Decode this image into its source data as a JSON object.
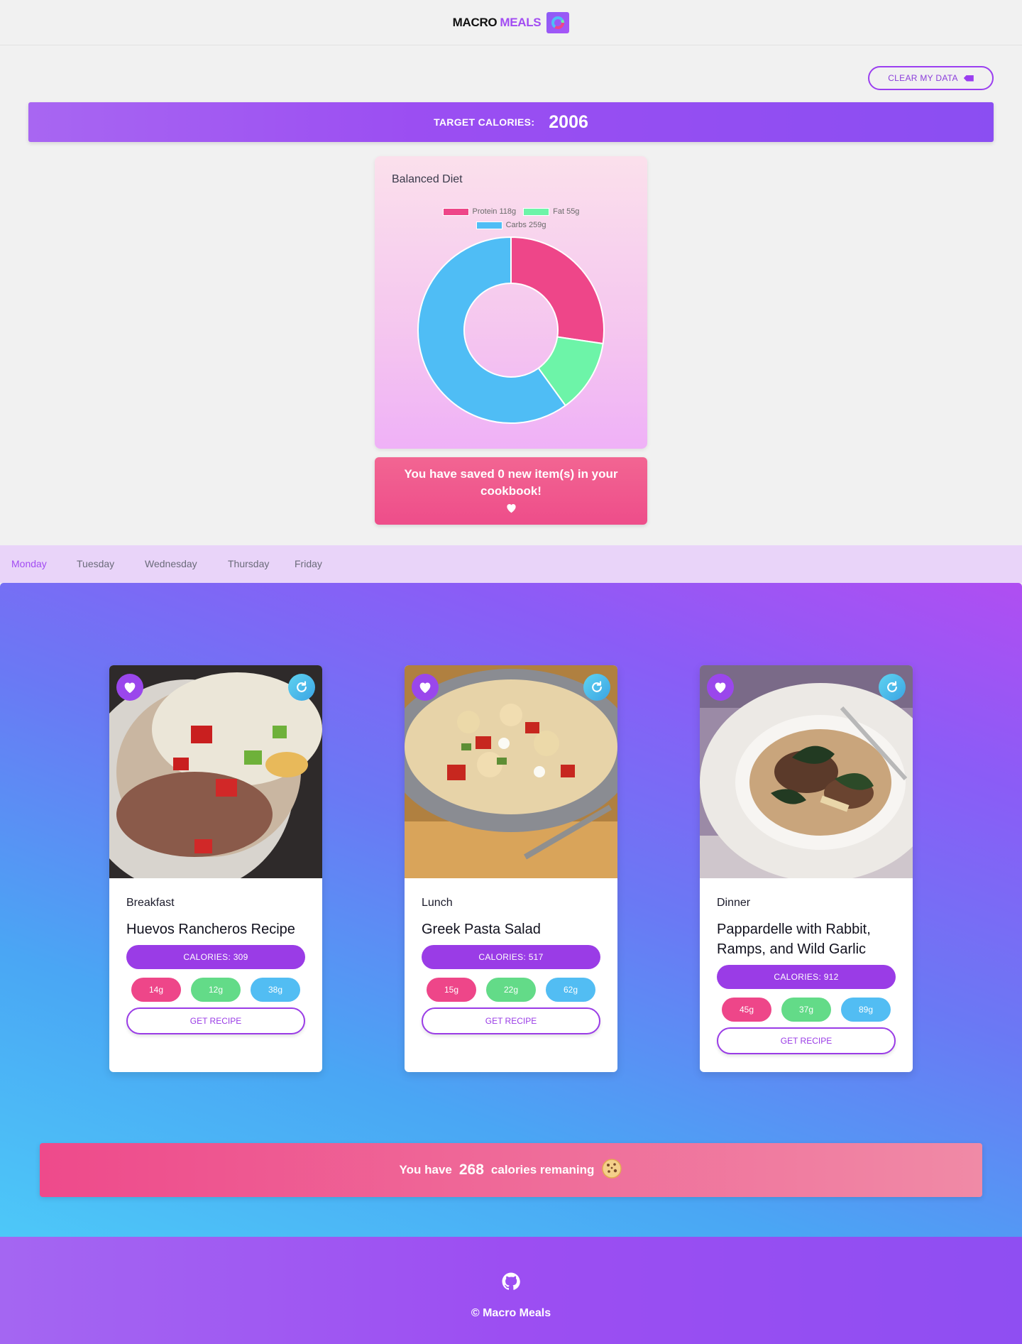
{
  "header": {
    "logo_macro": "MACRO",
    "logo_meals": "MEALS",
    "logo_icon": "donut-logo-icon"
  },
  "clear_button": {
    "label": "CLEAR MY DATA",
    "icon": "backspace-icon"
  },
  "target": {
    "label": "TARGET CALORIES:",
    "value": "2006"
  },
  "chart": {
    "title": "Balanced Diet",
    "legend": [
      {
        "label": "Protein 118g",
        "color": "#ee4689"
      },
      {
        "label": "Fat 55g",
        "color": "#6df4a8"
      },
      {
        "label": "Carbs 259g",
        "color": "#4fbdf5"
      }
    ]
  },
  "chart_data": {
    "type": "pie",
    "title": "Balanced Diet",
    "categories": [
      "Protein",
      "Fat",
      "Carbs"
    ],
    "values": [
      118,
      55,
      259
    ],
    "units": "g",
    "colors": [
      "#ee4689",
      "#6df4a8",
      "#4fbdf5"
    ],
    "legend_position": "top"
  },
  "saved": {
    "text": "You have saved 0 new item(s) in your cookbook!",
    "icon": "heart-icon"
  },
  "tabs": [
    {
      "label": "Monday",
      "active": true
    },
    {
      "label": "Tuesday",
      "active": false
    },
    {
      "label": "Wednesday",
      "active": false
    },
    {
      "label": "Thursday",
      "active": false
    },
    {
      "label": "Friday",
      "active": false
    }
  ],
  "meals": [
    {
      "type": "Breakfast",
      "title": "Huevos Rancheros Recipe",
      "calories_label": "CALORIES: 309",
      "protein": "14g",
      "fat": "12g",
      "carbs": "38g",
      "button": "GET RECIPE"
    },
    {
      "type": "Lunch",
      "title": "Greek Pasta Salad",
      "calories_label": "CALORIES: 517",
      "protein": "15g",
      "fat": "22g",
      "carbs": "62g",
      "button": "GET RECIPE"
    },
    {
      "type": "Dinner",
      "title": "Pappardelle with Rabbit, Ramps, and Wild Garlic",
      "calories_label": "CALORIES: 912",
      "protein": "45g",
      "fat": "37g",
      "carbs": "89g",
      "button": "GET RECIPE"
    }
  ],
  "macro_colors": {
    "protein": "#ee4689",
    "fat": "#63db88",
    "carbs": "#52bdf3"
  },
  "remaining": {
    "prefix": "You have",
    "value": "268",
    "suffix": "calories remaning",
    "icon": "cookie-icon"
  },
  "footer": {
    "icon": "github-icon",
    "copyright": "© Macro Meals"
  }
}
